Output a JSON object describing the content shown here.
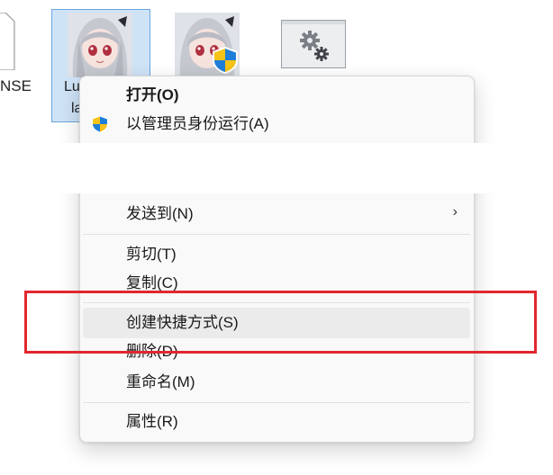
{
  "desktop": {
    "partial_file_label": "NSE",
    "selected_file_label_line1": "Lu",
    "selected_file_label_line2": "la"
  },
  "context_menu": {
    "items": [
      {
        "label": "打开(O)",
        "bold": true
      },
      {
        "label": "以管理员身份运行(A)",
        "icon": "uac-shield-icon"
      },
      {
        "label": "发送到(N)",
        "has_submenu": true
      },
      {
        "label": "剪切(T)"
      },
      {
        "label": "复制(C)"
      },
      {
        "label": "创建快捷方式(S)",
        "hovered": true
      },
      {
        "label": "删除(D)"
      },
      {
        "label": "重命名(M)"
      },
      {
        "label": "属性(R)"
      }
    ],
    "submenu_arrow": "›"
  },
  "colors": {
    "highlight_box": "#e1272d",
    "selection_fill": "#cfe3f7",
    "hover_fill": "#ebebeb"
  }
}
